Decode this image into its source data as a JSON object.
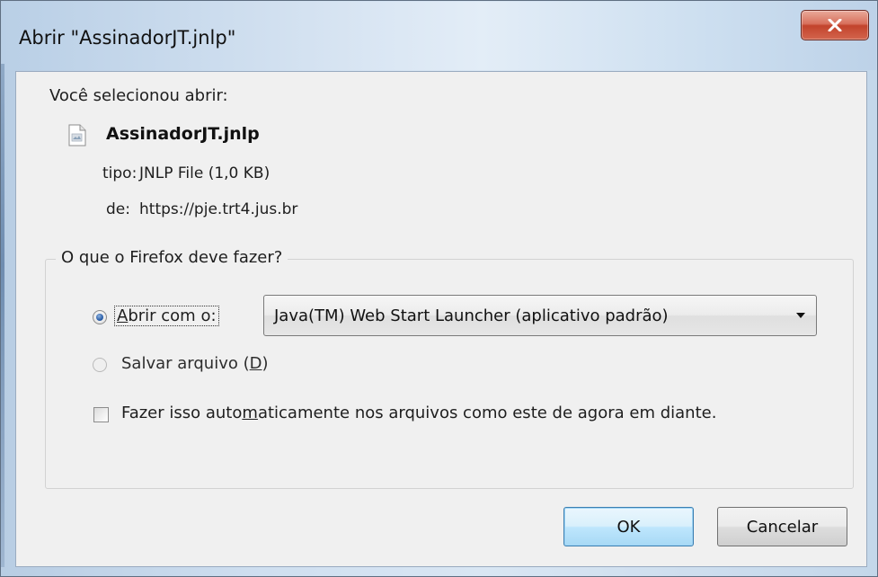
{
  "window": {
    "title": "Abrir \"AssinadorJT.jnlp\"",
    "close_icon": "close-icon"
  },
  "file": {
    "intro": "Você selecionou abrir:",
    "name": "AssinadorJT.jnlp",
    "icon": "file-icon",
    "type_label": "tipo:",
    "type_value": "JNLP File (1,0 KB)",
    "from_label": "de:",
    "from_value": "https://pje.trt4.jus.br"
  },
  "action": {
    "legend": "O que o Firefox deve fazer?",
    "open_with": {
      "accel": "A",
      "rest": "brir com o:",
      "selected": true
    },
    "application": {
      "selected": "Java(TM) Web Start Launcher (aplicativo padrão)"
    },
    "save": {
      "prefix": "Salvar arquivo (",
      "accel": "D",
      "suffix": ")",
      "selected": false
    },
    "auto": {
      "prefix": "Fazer isso auto",
      "accel": "m",
      "suffix": "aticamente nos arquivos como este de agora em diante.",
      "checked": false
    }
  },
  "buttons": {
    "ok": "OK",
    "cancel": "Cancelar"
  },
  "colors": {
    "close_button": "#c2432c",
    "radio_selected": "#2a5ea8",
    "ok_button_border": "#3c7fb1"
  }
}
